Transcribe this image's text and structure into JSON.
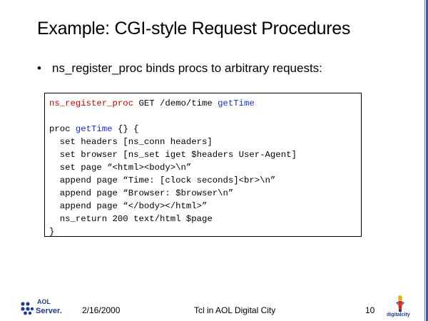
{
  "slide": {
    "title": "Example: CGI-style Request Procedures",
    "bullet_marker": "•",
    "bullet_text": "ns_register_proc binds procs to arbitrary requests:"
  },
  "code": {
    "line1_cmd": "ns_register_proc",
    "line1_mid": " GET /demo/time ",
    "line1_proc": "getTime",
    "line2_blank": " ",
    "line3_kw": "proc ",
    "line3_proc": "getTime",
    "line3_rest": " {} {",
    "line4": "  set headers [ns_conn headers]",
    "line5": "  set browser [ns_set iget $headers User-Agent]",
    "line6": "  set page “<html><body>\\n”",
    "line7": "  append page “Time: [clock seconds]<br>\\n”",
    "line8": "  append page “Browser: $browser\\n”",
    "line9": "  append page “</body></html>”",
    "line10": "  ns_return 200 text/html $page",
    "line11": "}"
  },
  "footer": {
    "date": "2/16/2000",
    "title": "Tcl in AOL Digital City",
    "page": "10"
  },
  "logos": {
    "aol_top": "AOL",
    "aol_bottom": "Server.",
    "digitalcity": "digitalcity"
  },
  "colors": {
    "keyword_red": "#c00000",
    "proc_blue": "#1a2ec0",
    "logo_blue": "#1d3b8f",
    "edge_rule": "#3d5aa8"
  }
}
